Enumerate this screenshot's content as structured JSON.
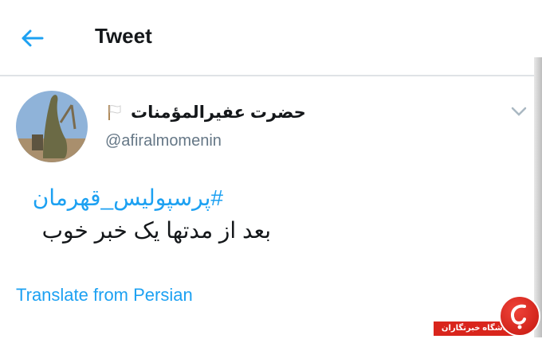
{
  "header": {
    "title": "Tweet",
    "back_icon": "arrow-left-icon",
    "accent": "#1da1f2"
  },
  "tweet": {
    "display_name": "حضرت عفیرالمؤمنات",
    "flag_emoji": "white-flag-icon",
    "handle": "@afiralmomenin",
    "hashtag": "#پرسپولیس_قهرمان",
    "text": "بعد از مدتها یک خبر خوب",
    "translate_label": "Translate from Persian",
    "menu_icon": "chevron-down-icon"
  },
  "watermark": {
    "label": "باشگاه خبرنگاران",
    "color": "#d9251c"
  }
}
